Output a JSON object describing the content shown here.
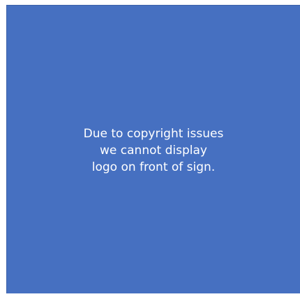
{
  "colors": {
    "panel_background": "#4670c1",
    "text": "#ffffff",
    "page_background": "#ffffff"
  },
  "notice": {
    "lines": [
      "Due to copyright issues",
      "we cannot display",
      "logo on front of sign."
    ]
  }
}
